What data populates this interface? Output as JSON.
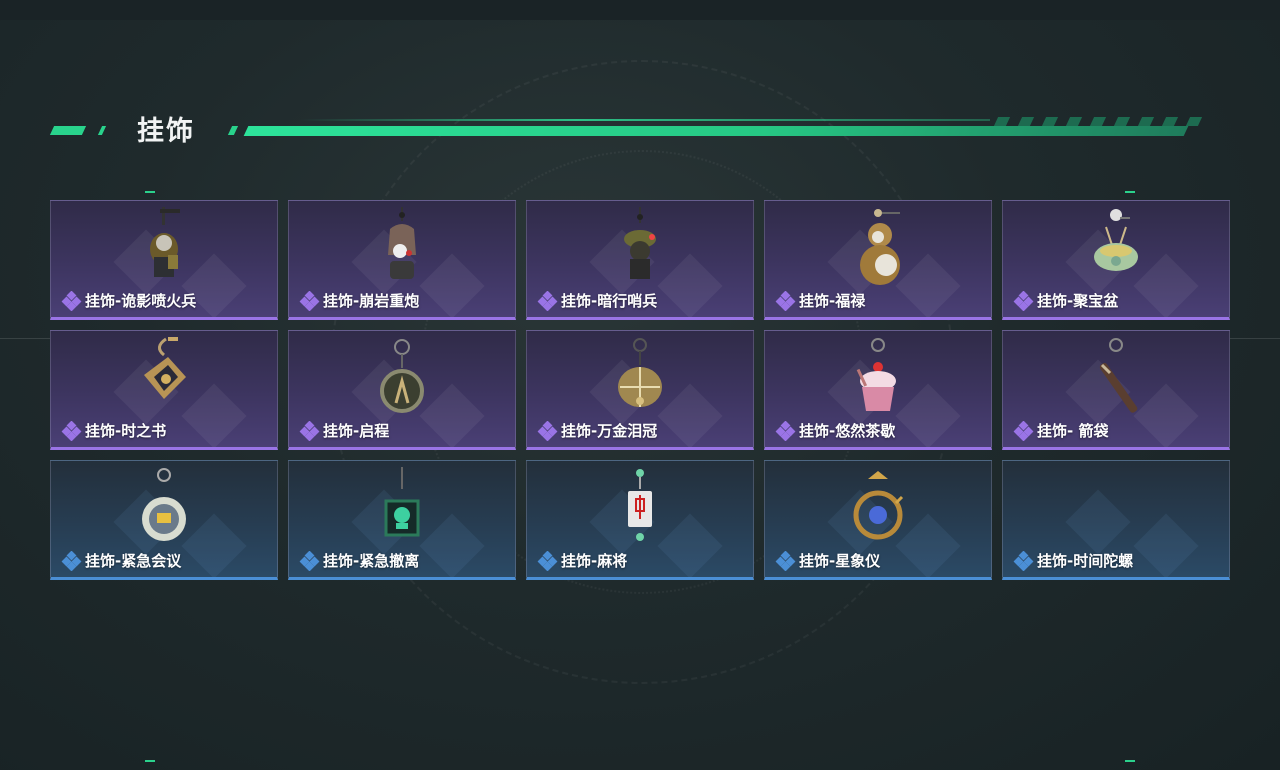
{
  "section": {
    "title": "挂饰"
  },
  "colors": {
    "accent": "#29d38c",
    "purple_rarity": "#9a74e6",
    "blue_rarity": "#4b8fd6"
  },
  "items": [
    {
      "name": "挂饰-诡影喷火兵",
      "rarity": "purple",
      "icon": "flamethrower-soldier-charm-icon"
    },
    {
      "name": "挂饰-崩岩重炮",
      "rarity": "purple",
      "icon": "rock-cannon-charm-icon"
    },
    {
      "name": "挂饰-暗行哨兵",
      "rarity": "purple",
      "icon": "sentry-charm-icon"
    },
    {
      "name": "挂饰-福禄",
      "rarity": "purple",
      "icon": "gourd-charm-icon"
    },
    {
      "name": "挂饰-聚宝盆",
      "rarity": "purple",
      "icon": "treasure-bowl-charm-icon"
    },
    {
      "name": "挂饰-时之书",
      "rarity": "purple",
      "icon": "book-charm-icon"
    },
    {
      "name": "挂饰-启程",
      "rarity": "purple",
      "icon": "ring-medallion-charm-icon"
    },
    {
      "name": "挂饰-万金泪冠",
      "rarity": "purple",
      "icon": "golden-crown-charm-icon"
    },
    {
      "name": "挂饰-悠然茶歇",
      "rarity": "purple",
      "icon": "cupcake-charm-icon"
    },
    {
      "name": "挂饰- 箭袋",
      "rarity": "purple",
      "icon": "quiver-charm-icon"
    },
    {
      "name": "挂饰-紧急会议",
      "rarity": "blue",
      "icon": "meeting-badge-charm-icon"
    },
    {
      "name": "挂饰-紧急撤离",
      "rarity": "blue",
      "icon": "skull-box-charm-icon"
    },
    {
      "name": "挂饰-麻将",
      "rarity": "blue",
      "icon": "mahjong-tile-charm-icon"
    },
    {
      "name": "挂饰-星象仪",
      "rarity": "blue",
      "icon": "astrolabe-charm-icon"
    },
    {
      "name": "挂饰-时间陀螺",
      "rarity": "blue",
      "icon": ""
    }
  ]
}
